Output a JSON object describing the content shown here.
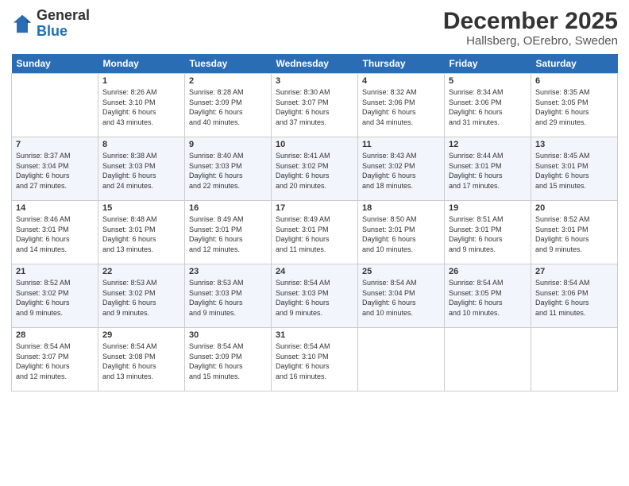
{
  "header": {
    "logo_general": "General",
    "logo_blue": "Blue",
    "month": "December 2025",
    "location": "Hallsberg, OErebro, Sweden"
  },
  "weekdays": [
    "Sunday",
    "Monday",
    "Tuesday",
    "Wednesday",
    "Thursday",
    "Friday",
    "Saturday"
  ],
  "weeks": [
    [
      {
        "day": "",
        "info": ""
      },
      {
        "day": "1",
        "info": "Sunrise: 8:26 AM\nSunset: 3:10 PM\nDaylight: 6 hours\nand 43 minutes."
      },
      {
        "day": "2",
        "info": "Sunrise: 8:28 AM\nSunset: 3:09 PM\nDaylight: 6 hours\nand 40 minutes."
      },
      {
        "day": "3",
        "info": "Sunrise: 8:30 AM\nSunset: 3:07 PM\nDaylight: 6 hours\nand 37 minutes."
      },
      {
        "day": "4",
        "info": "Sunrise: 8:32 AM\nSunset: 3:06 PM\nDaylight: 6 hours\nand 34 minutes."
      },
      {
        "day": "5",
        "info": "Sunrise: 8:34 AM\nSunset: 3:06 PM\nDaylight: 6 hours\nand 31 minutes."
      },
      {
        "day": "6",
        "info": "Sunrise: 8:35 AM\nSunset: 3:05 PM\nDaylight: 6 hours\nand 29 minutes."
      }
    ],
    [
      {
        "day": "7",
        "info": "Sunrise: 8:37 AM\nSunset: 3:04 PM\nDaylight: 6 hours\nand 27 minutes."
      },
      {
        "day": "8",
        "info": "Sunrise: 8:38 AM\nSunset: 3:03 PM\nDaylight: 6 hours\nand 24 minutes."
      },
      {
        "day": "9",
        "info": "Sunrise: 8:40 AM\nSunset: 3:03 PM\nDaylight: 6 hours\nand 22 minutes."
      },
      {
        "day": "10",
        "info": "Sunrise: 8:41 AM\nSunset: 3:02 PM\nDaylight: 6 hours\nand 20 minutes."
      },
      {
        "day": "11",
        "info": "Sunrise: 8:43 AM\nSunset: 3:02 PM\nDaylight: 6 hours\nand 18 minutes."
      },
      {
        "day": "12",
        "info": "Sunrise: 8:44 AM\nSunset: 3:01 PM\nDaylight: 6 hours\nand 17 minutes."
      },
      {
        "day": "13",
        "info": "Sunrise: 8:45 AM\nSunset: 3:01 PM\nDaylight: 6 hours\nand 15 minutes."
      }
    ],
    [
      {
        "day": "14",
        "info": "Sunrise: 8:46 AM\nSunset: 3:01 PM\nDaylight: 6 hours\nand 14 minutes."
      },
      {
        "day": "15",
        "info": "Sunrise: 8:48 AM\nSunset: 3:01 PM\nDaylight: 6 hours\nand 13 minutes."
      },
      {
        "day": "16",
        "info": "Sunrise: 8:49 AM\nSunset: 3:01 PM\nDaylight: 6 hours\nand 12 minutes."
      },
      {
        "day": "17",
        "info": "Sunrise: 8:49 AM\nSunset: 3:01 PM\nDaylight: 6 hours\nand 11 minutes."
      },
      {
        "day": "18",
        "info": "Sunrise: 8:50 AM\nSunset: 3:01 PM\nDaylight: 6 hours\nand 10 minutes."
      },
      {
        "day": "19",
        "info": "Sunrise: 8:51 AM\nSunset: 3:01 PM\nDaylight: 6 hours\nand 9 minutes."
      },
      {
        "day": "20",
        "info": "Sunrise: 8:52 AM\nSunset: 3:01 PM\nDaylight: 6 hours\nand 9 minutes."
      }
    ],
    [
      {
        "day": "21",
        "info": "Sunrise: 8:52 AM\nSunset: 3:02 PM\nDaylight: 6 hours\nand 9 minutes."
      },
      {
        "day": "22",
        "info": "Sunrise: 8:53 AM\nSunset: 3:02 PM\nDaylight: 6 hours\nand 9 minutes."
      },
      {
        "day": "23",
        "info": "Sunrise: 8:53 AM\nSunset: 3:03 PM\nDaylight: 6 hours\nand 9 minutes."
      },
      {
        "day": "24",
        "info": "Sunrise: 8:54 AM\nSunset: 3:03 PM\nDaylight: 6 hours\nand 9 minutes."
      },
      {
        "day": "25",
        "info": "Sunrise: 8:54 AM\nSunset: 3:04 PM\nDaylight: 6 hours\nand 10 minutes."
      },
      {
        "day": "26",
        "info": "Sunrise: 8:54 AM\nSunset: 3:05 PM\nDaylight: 6 hours\nand 10 minutes."
      },
      {
        "day": "27",
        "info": "Sunrise: 8:54 AM\nSunset: 3:06 PM\nDaylight: 6 hours\nand 11 minutes."
      }
    ],
    [
      {
        "day": "28",
        "info": "Sunrise: 8:54 AM\nSunset: 3:07 PM\nDaylight: 6 hours\nand 12 minutes."
      },
      {
        "day": "29",
        "info": "Sunrise: 8:54 AM\nSunset: 3:08 PM\nDaylight: 6 hours\nand 13 minutes."
      },
      {
        "day": "30",
        "info": "Sunrise: 8:54 AM\nSunset: 3:09 PM\nDaylight: 6 hours\nand 15 minutes."
      },
      {
        "day": "31",
        "info": "Sunrise: 8:54 AM\nSunset: 3:10 PM\nDaylight: 6 hours\nand 16 minutes."
      },
      {
        "day": "",
        "info": ""
      },
      {
        "day": "",
        "info": ""
      },
      {
        "day": "",
        "info": ""
      }
    ]
  ]
}
